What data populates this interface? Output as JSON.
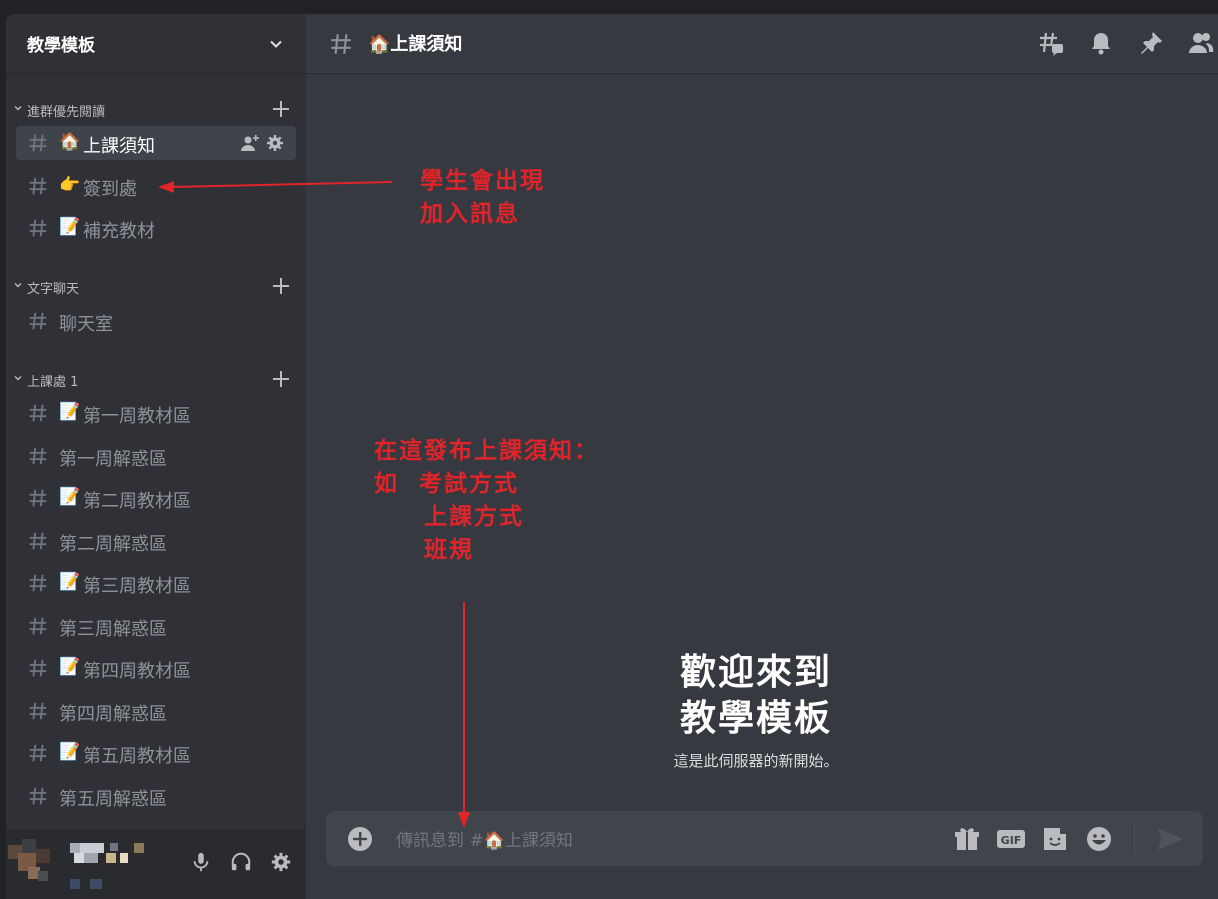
{
  "server": {
    "name": "教學模板"
  },
  "categories": [
    {
      "label": "進群優先閱讀"
    },
    {
      "label": "文字聊天"
    },
    {
      "label": "上課處 1"
    }
  ],
  "channels": [
    {
      "emoji": "🏠",
      "label": "上課須知",
      "active": true
    },
    {
      "emoji": "👉",
      "label": "簽到處"
    },
    {
      "emoji": "📝",
      "label": "補充教材"
    },
    {
      "emoji": "",
      "label": "聊天室"
    },
    {
      "emoji": "📝",
      "label": "第一周教材區"
    },
    {
      "emoji": "",
      "label": "第一周解惑區"
    },
    {
      "emoji": "📝",
      "label": "第二周教材區"
    },
    {
      "emoji": "",
      "label": "第二周解惑區"
    },
    {
      "emoji": "📝",
      "label": "第三周教材區"
    },
    {
      "emoji": "",
      "label": "第三周解惑區"
    },
    {
      "emoji": "📝",
      "label": "第四周教材區"
    },
    {
      "emoji": "",
      "label": "第四周解惑區"
    },
    {
      "emoji": "📝",
      "label": "第五周教材區"
    },
    {
      "emoji": "",
      "label": "第五周解惑區"
    }
  ],
  "header": {
    "channel_title": "🏠上課須知"
  },
  "welcome": {
    "line1": "歡迎來到",
    "line2": "教學模板",
    "subtitle": "這是此伺服器的新開始。"
  },
  "composer": {
    "placeholder": "傳訊息到 #🏠上課須知"
  },
  "annotations": {
    "signin_note": "學生會出現\n加入訊息",
    "notice_note": "在這發布上課須知：\n如  考試方式\n     上課方式\n     班規"
  },
  "icons": {
    "topbar": [
      "threads-icon",
      "bell-icon",
      "pin-icon",
      "members-icon"
    ],
    "composer": [
      "gift-icon",
      "gif-icon",
      "sticker-icon",
      "emoji-icon",
      "send-icon"
    ],
    "userbar": [
      "microphone-icon",
      "headphones-icon",
      "settings-icon"
    ]
  },
  "colors": {
    "sidebar_bg": "#2f3136",
    "main_bg": "#36393f",
    "active_channel_bg": "#3f434a",
    "annotation_red": "#e0242a",
    "muted_text": "#8e9297"
  }
}
